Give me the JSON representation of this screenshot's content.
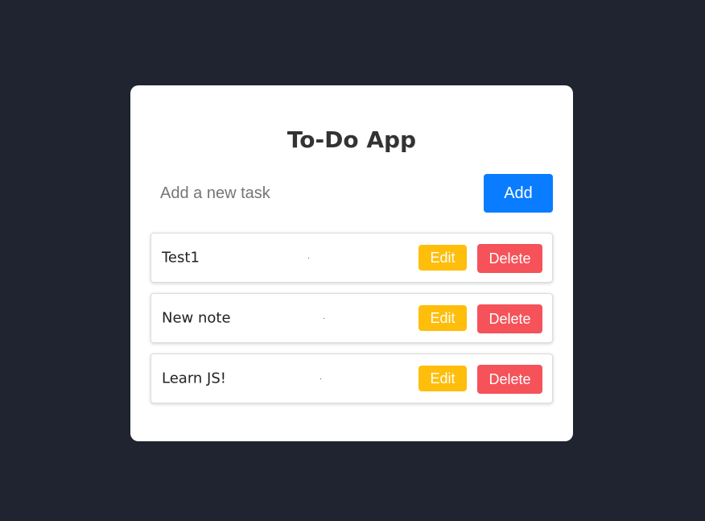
{
  "app": {
    "title": "To-Do App"
  },
  "new_task": {
    "placeholder": "Add a new task",
    "value": "",
    "add_label": "Add"
  },
  "tasks": [
    {
      "text": "Test1",
      "edit_label": "Edit",
      "delete_label": "Delete"
    },
    {
      "text": "New note",
      "edit_label": "Edit",
      "delete_label": "Delete"
    },
    {
      "text": "Learn JS!",
      "edit_label": "Edit",
      "delete_label": "Delete"
    }
  ],
  "colors": {
    "background": "#1f2430",
    "card": "#ffffff",
    "add_button": "#0a7cff",
    "edit_button": "#ffbe0b",
    "delete_button": "#f5525a"
  }
}
